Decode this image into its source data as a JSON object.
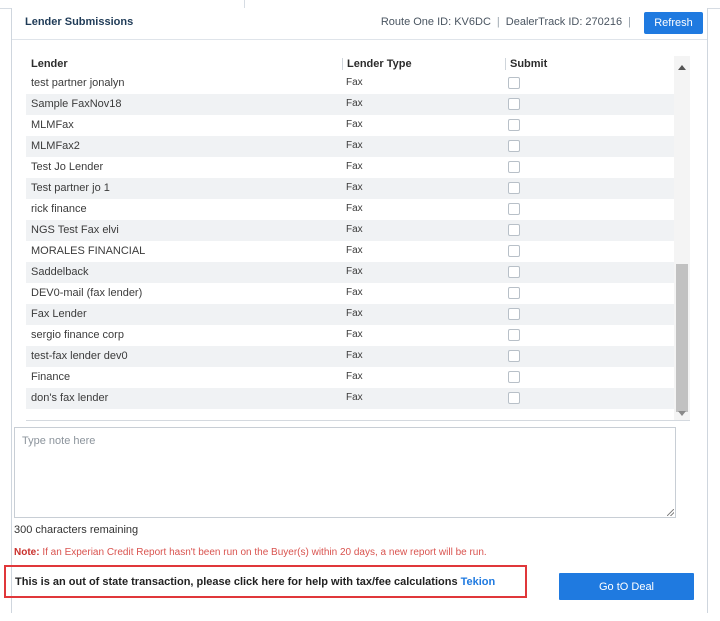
{
  "header": {
    "title": "Lender Submissions",
    "route_one": "Route One ID: KV6DC",
    "separator": "|",
    "dealertrack": "DealerTrack ID: 270216",
    "refresh_label": "Refresh"
  },
  "table": {
    "columns": [
      "Lender",
      "Lender Type",
      "Submit"
    ],
    "rows": [
      {
        "lender": "test partner jonalyn",
        "type": "Fax",
        "submit": false
      },
      {
        "lender": "Sample FaxNov18",
        "type": "Fax",
        "submit": false
      },
      {
        "lender": "MLMFax",
        "type": "Fax",
        "submit": false
      },
      {
        "lender": "MLMFax2",
        "type": "Fax",
        "submit": false
      },
      {
        "lender": "Test Jo Lender",
        "type": "Fax",
        "submit": false
      },
      {
        "lender": "Test partner jo 1",
        "type": "Fax",
        "submit": false
      },
      {
        "lender": "rick finance",
        "type": "Fax",
        "submit": false
      },
      {
        "lender": "NGS Test Fax elvi",
        "type": "Fax",
        "submit": false
      },
      {
        "lender": "MORALES FINANCIAL",
        "type": "Fax",
        "submit": false
      },
      {
        "lender": "Saddelback",
        "type": "Fax",
        "submit": false
      },
      {
        "lender": "DEV0-mail (fax lender)",
        "type": "Fax",
        "submit": false
      },
      {
        "lender": "Fax Lender",
        "type": "Fax",
        "submit": false
      },
      {
        "lender": "sergio finance corp",
        "type": "Fax",
        "submit": false
      },
      {
        "lender": "test-fax lender dev0",
        "type": "Fax",
        "submit": false
      },
      {
        "lender": "Finance",
        "type": "Fax",
        "submit": false
      },
      {
        "lender": "don's fax lender",
        "type": "Fax",
        "submit": false
      }
    ]
  },
  "note": {
    "placeholder": "Type note here",
    "value": "",
    "remaining": "300 characters remaining"
  },
  "experian": {
    "label": "Note:",
    "text": " If an Experian Credit Report hasn't been run on the Buyer(s) within 20 days, a new report will be run."
  },
  "out_of_state": {
    "text": "This is an out of state transaction, please click here for help with tax/fee calculations",
    "link": "Tekion"
  },
  "goto_label": "Go tO Deal",
  "colors": {
    "accent": "#1f7ae0",
    "warning": "#d9534f",
    "highlight_border": "#e0373a"
  }
}
